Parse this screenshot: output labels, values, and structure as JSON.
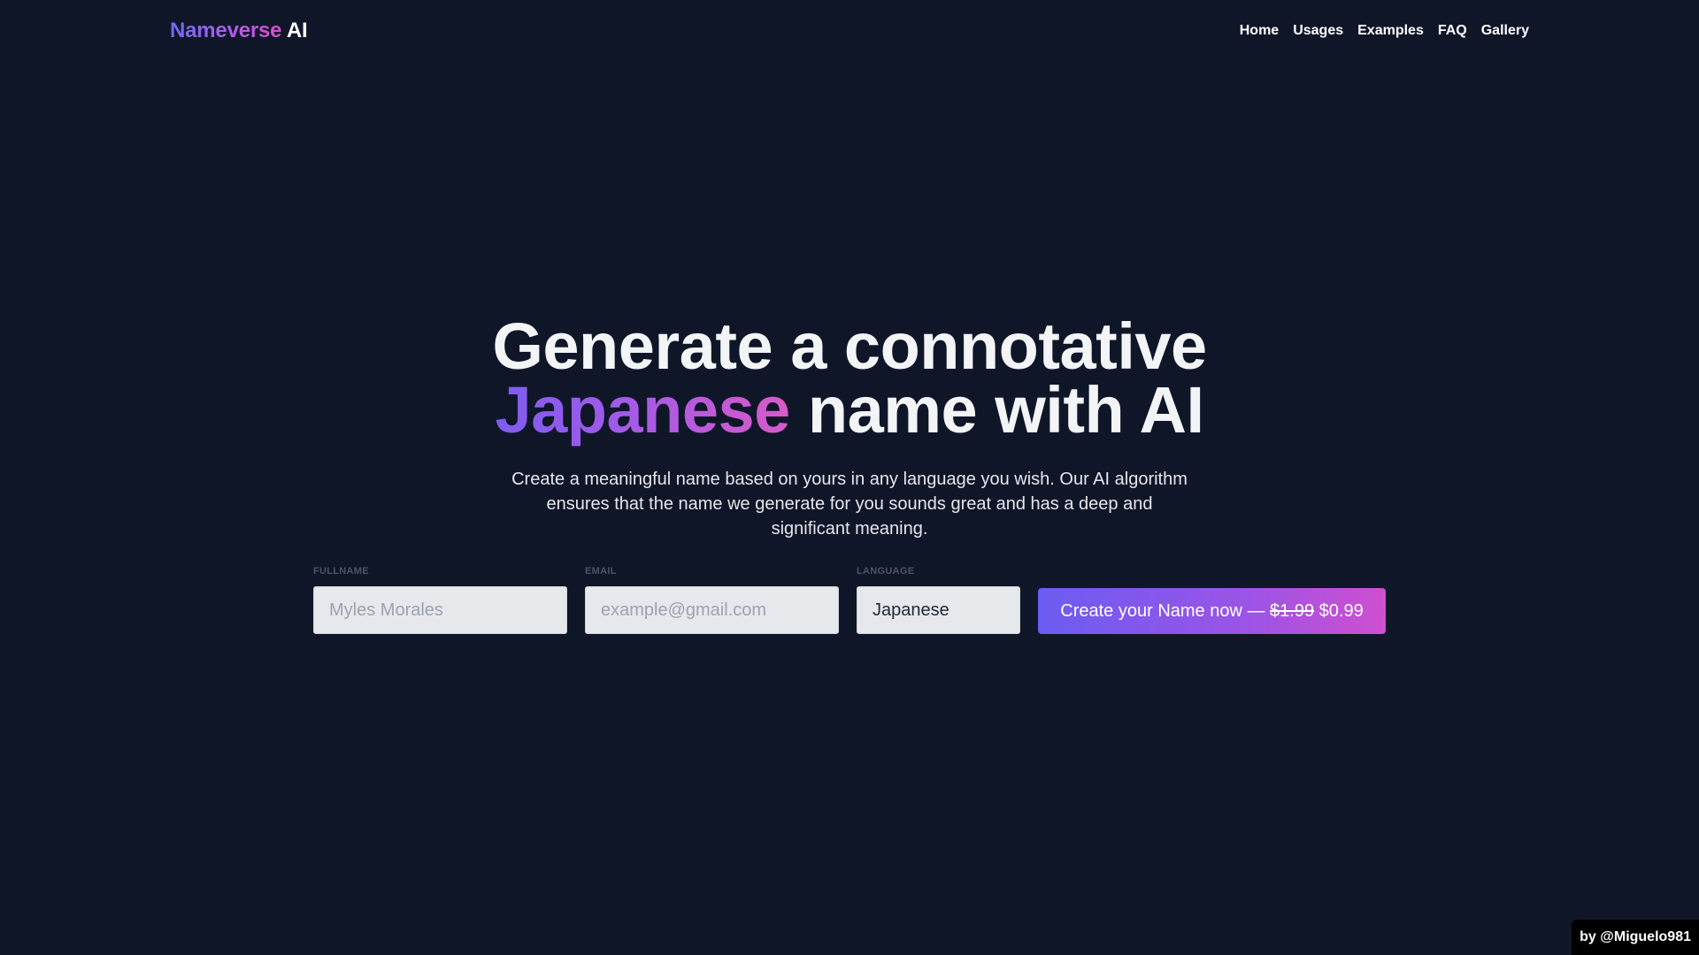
{
  "brand": {
    "name_part1": "Nameverse",
    "name_part2": "AI"
  },
  "nav": {
    "items": [
      "Home",
      "Usages",
      "Examples",
      "FAQ",
      "Gallery"
    ]
  },
  "hero": {
    "headline_line1": "Generate a connotative",
    "headline_accent": "Japanese",
    "headline_rest": "name with AI",
    "subtitle": "Create a meaningful name based on yours in any language you wish. Our AI algorithm ensures that the name we generate for you sounds great and has a deep and significant meaning."
  },
  "form": {
    "fullname": {
      "label": "FULLNAME",
      "placeholder": "Myles Morales",
      "value": ""
    },
    "email": {
      "label": "EMAIL",
      "placeholder": "example@gmail.com",
      "value": ""
    },
    "language": {
      "label": "LANGUAGE",
      "value": "Japanese"
    },
    "cta": {
      "text": "Create your Name now — ",
      "old_price": "$1.99",
      "new_price": "$0.99"
    }
  },
  "credit": "by @Miguelo981",
  "colors": {
    "background": "#0f1628",
    "accent_start": "#6d6af5",
    "accent_end": "#d84fc9"
  }
}
